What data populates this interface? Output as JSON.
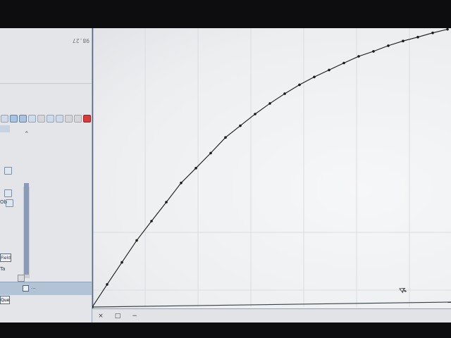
{
  "left_panel": {
    "caption": "98.27",
    "toolbar": {
      "buttons": [
        {
          "icon": "pin-icon",
          "style": "normal"
        },
        {
          "icon": "select-icon",
          "style": "sel"
        },
        {
          "icon": "edit-icon",
          "style": "sel"
        },
        {
          "icon": "move-icon",
          "style": "normal"
        },
        {
          "icon": "copy-icon",
          "style": "gray"
        },
        {
          "icon": "grid-icon",
          "style": "normal"
        },
        {
          "icon": "link-icon",
          "style": "normal"
        },
        {
          "icon": "delete-icon",
          "style": "gray"
        },
        {
          "icon": "close-icon",
          "style": "gray"
        },
        {
          "icon": "stop-icon",
          "style": "red"
        }
      ]
    },
    "object_label": "Ob",
    "field_button": "Field",
    "label_tri": "Ta",
    "footer_text": "...",
    "bottom_button": "Que"
  },
  "window_controls": {
    "close": "×",
    "restore": "□",
    "minimize": "−"
  },
  "chart_data": {
    "type": "line",
    "title": "",
    "xlabel": "",
    "ylabel": "",
    "x": [
      0,
      1,
      2,
      3,
      4,
      5,
      6,
      7,
      8,
      9,
      10,
      11,
      12,
      13,
      14,
      15,
      16,
      17,
      18,
      19,
      20,
      21,
      22,
      23,
      24
    ],
    "y": [
      0.0,
      0.081,
      0.16,
      0.239,
      0.308,
      0.376,
      0.445,
      0.498,
      0.552,
      0.608,
      0.65,
      0.692,
      0.73,
      0.765,
      0.797,
      0.825,
      0.85,
      0.875,
      0.899,
      0.917,
      0.937,
      0.954,
      0.968,
      0.983,
      0.996
    ],
    "xlim": [
      0,
      25
    ],
    "ylim": [
      0,
      1
    ],
    "grid": true,
    "marker": "dot",
    "line_color": "#1a1a1a"
  }
}
